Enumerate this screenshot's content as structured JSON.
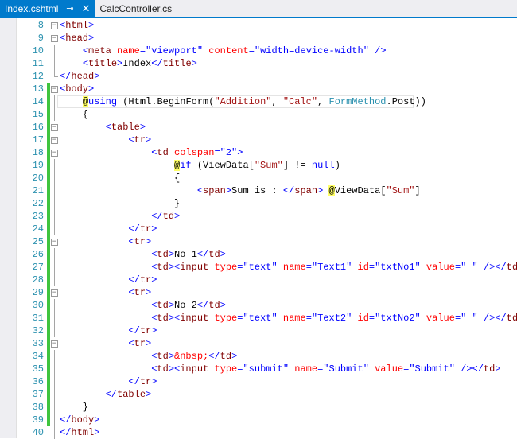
{
  "tabs": [
    {
      "label": "Index.cshtml",
      "active": true,
      "pin_icon": "pin-icon",
      "close_icon": "close-icon"
    },
    {
      "label": "CalcController.cs",
      "active": false
    }
  ],
  "colors": {
    "accent": "#007acc",
    "change_bar": "#3fc43f"
  },
  "current_line": 14,
  "lines": [
    {
      "n": 8,
      "ol": "box",
      "chg": false,
      "tokens": [
        [
          "b",
          "<"
        ],
        [
          "t",
          "html"
        ],
        [
          "b",
          ">"
        ]
      ]
    },
    {
      "n": 9,
      "ol": "box",
      "chg": false,
      "tokens": [
        [
          "b",
          "<"
        ],
        [
          "t",
          "head"
        ],
        [
          "b",
          ">"
        ]
      ]
    },
    {
      "n": 10,
      "ol": "line",
      "chg": false,
      "tokens": [
        [
          "p",
          "    "
        ],
        [
          "b",
          "<"
        ],
        [
          "t",
          "meta "
        ],
        [
          "a",
          "name"
        ],
        [
          "b",
          "=\"viewport\" "
        ],
        [
          "a",
          "content"
        ],
        [
          "b",
          "=\"width=device-width\" />"
        ]
      ]
    },
    {
      "n": 11,
      "ol": "line",
      "chg": false,
      "tokens": [
        [
          "p",
          "    "
        ],
        [
          "b",
          "<"
        ],
        [
          "t",
          "title"
        ],
        [
          "b",
          ">"
        ],
        [
          "p",
          "Index"
        ],
        [
          "b",
          "</"
        ],
        [
          "t",
          "title"
        ],
        [
          "b",
          ">"
        ]
      ]
    },
    {
      "n": 12,
      "ol": "end",
      "chg": false,
      "tokens": [
        [
          "b",
          "</"
        ],
        [
          "t",
          "head"
        ],
        [
          "b",
          ">"
        ]
      ]
    },
    {
      "n": 13,
      "ol": "box",
      "chg": true,
      "tokens": [
        [
          "b",
          "<"
        ],
        [
          "t",
          "body"
        ],
        [
          "b",
          ">"
        ]
      ]
    },
    {
      "n": 14,
      "ol": "line",
      "chg": true,
      "tokens": [
        [
          "p",
          "    "
        ],
        [
          "r",
          "@"
        ],
        [
          "k",
          "using"
        ],
        [
          "p",
          " (Html.BeginForm("
        ],
        [
          "s",
          "\"Addition\""
        ],
        [
          "p",
          ", "
        ],
        [
          "s",
          "\"Calc\""
        ],
        [
          "p",
          ", "
        ],
        [
          "ty",
          "FormMethod"
        ],
        [
          "p",
          ".Post))"
        ]
      ]
    },
    {
      "n": 15,
      "ol": "line",
      "chg": true,
      "tokens": [
        [
          "p",
          "    {"
        ]
      ]
    },
    {
      "n": 16,
      "ol": "box",
      "chg": true,
      "tokens": [
        [
          "p",
          "        "
        ],
        [
          "b",
          "<"
        ],
        [
          "t",
          "table"
        ],
        [
          "b",
          ">"
        ]
      ]
    },
    {
      "n": 17,
      "ol": "box",
      "chg": true,
      "tokens": [
        [
          "p",
          "            "
        ],
        [
          "b",
          "<"
        ],
        [
          "t",
          "tr"
        ],
        [
          "b",
          ">"
        ]
      ]
    },
    {
      "n": 18,
      "ol": "box",
      "chg": true,
      "tokens": [
        [
          "p",
          "                "
        ],
        [
          "b",
          "<"
        ],
        [
          "t",
          "td "
        ],
        [
          "a",
          "colspan"
        ],
        [
          "b",
          "=\"2\">"
        ]
      ]
    },
    {
      "n": 19,
      "ol": "line",
      "chg": true,
      "tokens": [
        [
          "p",
          "                    "
        ],
        [
          "r",
          "@"
        ],
        [
          "k",
          "if"
        ],
        [
          "p",
          " (ViewData["
        ],
        [
          "s",
          "\"Sum\""
        ],
        [
          "p",
          "] != "
        ],
        [
          "k",
          "null"
        ],
        [
          "p",
          ")"
        ]
      ]
    },
    {
      "n": 20,
      "ol": "line",
      "chg": true,
      "tokens": [
        [
          "p",
          "                    {"
        ]
      ]
    },
    {
      "n": 21,
      "ol": "line",
      "chg": true,
      "tokens": [
        [
          "p",
          "                        "
        ],
        [
          "b",
          "<"
        ],
        [
          "t",
          "span"
        ],
        [
          "b",
          ">"
        ],
        [
          "p",
          "Sum is : "
        ],
        [
          "b",
          "</"
        ],
        [
          "t",
          "span"
        ],
        [
          "b",
          ">"
        ],
        [
          "p",
          " "
        ],
        [
          "r",
          "@"
        ],
        [
          "p",
          "ViewData["
        ],
        [
          "s",
          "\"Sum\""
        ],
        [
          "p",
          "]"
        ]
      ]
    },
    {
      "n": 22,
      "ol": "line",
      "chg": true,
      "tokens": [
        [
          "p",
          "                    }"
        ]
      ]
    },
    {
      "n": 23,
      "ol": "line",
      "chg": true,
      "tokens": [
        [
          "p",
          "                "
        ],
        [
          "b",
          "</"
        ],
        [
          "t",
          "td"
        ],
        [
          "b",
          ">"
        ]
      ]
    },
    {
      "n": 24,
      "ol": "line",
      "chg": true,
      "tokens": [
        [
          "p",
          "            "
        ],
        [
          "b",
          "</"
        ],
        [
          "t",
          "tr"
        ],
        [
          "b",
          ">"
        ]
      ]
    },
    {
      "n": 25,
      "ol": "box",
      "chg": true,
      "tokens": [
        [
          "p",
          "            "
        ],
        [
          "b",
          "<"
        ],
        [
          "t",
          "tr"
        ],
        [
          "b",
          ">"
        ]
      ]
    },
    {
      "n": 26,
      "ol": "line",
      "chg": true,
      "tokens": [
        [
          "p",
          "                "
        ],
        [
          "b",
          "<"
        ],
        [
          "t",
          "td"
        ],
        [
          "b",
          ">"
        ],
        [
          "p",
          "No 1"
        ],
        [
          "b",
          "</"
        ],
        [
          "t",
          "td"
        ],
        [
          "b",
          ">"
        ]
      ]
    },
    {
      "n": 27,
      "ol": "line",
      "chg": true,
      "tokens": [
        [
          "p",
          "                "
        ],
        [
          "b",
          "<"
        ],
        [
          "t",
          "td"
        ],
        [
          "b",
          "><"
        ],
        [
          "t",
          "input "
        ],
        [
          "a",
          "type"
        ],
        [
          "b",
          "=\"text\" "
        ],
        [
          "a",
          "name"
        ],
        [
          "b",
          "=\"Text1\" "
        ],
        [
          "a",
          "id"
        ],
        [
          "b",
          "=\"txtNo1\" "
        ],
        [
          "a",
          "value"
        ],
        [
          "b",
          "=\" \" /></"
        ],
        [
          "t",
          "td"
        ],
        [
          "b",
          ">"
        ]
      ]
    },
    {
      "n": 28,
      "ol": "line",
      "chg": true,
      "tokens": [
        [
          "p",
          "            "
        ],
        [
          "b",
          "</"
        ],
        [
          "t",
          "tr"
        ],
        [
          "b",
          ">"
        ]
      ]
    },
    {
      "n": 29,
      "ol": "box",
      "chg": true,
      "tokens": [
        [
          "p",
          "            "
        ],
        [
          "b",
          "<"
        ],
        [
          "t",
          "tr"
        ],
        [
          "b",
          ">"
        ]
      ]
    },
    {
      "n": 30,
      "ol": "line",
      "chg": true,
      "tokens": [
        [
          "p",
          "                "
        ],
        [
          "b",
          "<"
        ],
        [
          "t",
          "td"
        ],
        [
          "b",
          ">"
        ],
        [
          "p",
          "No 2"
        ],
        [
          "b",
          "</"
        ],
        [
          "t",
          "td"
        ],
        [
          "b",
          ">"
        ]
      ]
    },
    {
      "n": 31,
      "ol": "line",
      "chg": true,
      "tokens": [
        [
          "p",
          "                "
        ],
        [
          "b",
          "<"
        ],
        [
          "t",
          "td"
        ],
        [
          "b",
          "><"
        ],
        [
          "t",
          "input "
        ],
        [
          "a",
          "type"
        ],
        [
          "b",
          "=\"text\" "
        ],
        [
          "a",
          "name"
        ],
        [
          "b",
          "=\"Text2\" "
        ],
        [
          "a",
          "id"
        ],
        [
          "b",
          "=\"txtNo2\" "
        ],
        [
          "a",
          "value"
        ],
        [
          "b",
          "=\" \" /></"
        ],
        [
          "t",
          "td"
        ],
        [
          "b",
          ">"
        ]
      ]
    },
    {
      "n": 32,
      "ol": "line",
      "chg": true,
      "tokens": [
        [
          "p",
          "            "
        ],
        [
          "b",
          "</"
        ],
        [
          "t",
          "tr"
        ],
        [
          "b",
          ">"
        ]
      ]
    },
    {
      "n": 33,
      "ol": "box",
      "chg": true,
      "tokens": [
        [
          "p",
          "            "
        ],
        [
          "b",
          "<"
        ],
        [
          "t",
          "tr"
        ],
        [
          "b",
          ">"
        ]
      ]
    },
    {
      "n": 34,
      "ol": "line",
      "chg": true,
      "tokens": [
        [
          "p",
          "                "
        ],
        [
          "b",
          "<"
        ],
        [
          "t",
          "td"
        ],
        [
          "b",
          ">"
        ],
        [
          "a",
          "&nbsp;"
        ],
        [
          "b",
          "</"
        ],
        [
          "t",
          "td"
        ],
        [
          "b",
          ">"
        ]
      ]
    },
    {
      "n": 35,
      "ol": "line",
      "chg": true,
      "tokens": [
        [
          "p",
          "                "
        ],
        [
          "b",
          "<"
        ],
        [
          "t",
          "td"
        ],
        [
          "b",
          "><"
        ],
        [
          "t",
          "input "
        ],
        [
          "a",
          "type"
        ],
        [
          "b",
          "=\"submit\" "
        ],
        [
          "a",
          "name"
        ],
        [
          "b",
          "=\"Submit\" "
        ],
        [
          "a",
          "value"
        ],
        [
          "b",
          "=\"Submit\" /></"
        ],
        [
          "t",
          "td"
        ],
        [
          "b",
          ">"
        ]
      ]
    },
    {
      "n": 36,
      "ol": "line",
      "chg": true,
      "tokens": [
        [
          "p",
          "            "
        ],
        [
          "b",
          "</"
        ],
        [
          "t",
          "tr"
        ],
        [
          "b",
          ">"
        ]
      ]
    },
    {
      "n": 37,
      "ol": "line",
      "chg": true,
      "tokens": [
        [
          "p",
          "        "
        ],
        [
          "b",
          "</"
        ],
        [
          "t",
          "table"
        ],
        [
          "b",
          ">"
        ]
      ]
    },
    {
      "n": 38,
      "ol": "line",
      "chg": true,
      "tokens": [
        [
          "p",
          "    }"
        ]
      ]
    },
    {
      "n": 39,
      "ol": "line",
      "chg": true,
      "tokens": [
        [
          "b",
          "</"
        ],
        [
          "t",
          "body"
        ],
        [
          "b",
          ">"
        ]
      ]
    },
    {
      "n": 40,
      "ol": "line",
      "chg": false,
      "tokens": [
        [
          "b",
          "</"
        ],
        [
          "t",
          "html"
        ],
        [
          "b",
          ">"
        ]
      ]
    }
  ]
}
